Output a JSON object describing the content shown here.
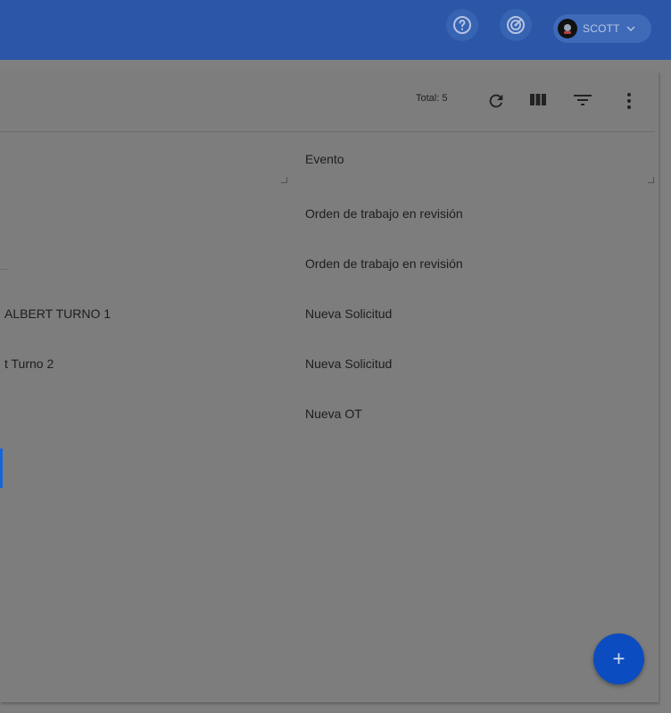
{
  "header": {
    "user_name": "SCOTT",
    "icons": [
      "help-icon",
      "target-icon",
      "avatar",
      "chevron-down-icon"
    ]
  },
  "toolbar": {
    "total_label": "Total: 5",
    "icons": [
      "refresh-icon",
      "columns-icon",
      "filter-icon",
      "more-icon"
    ]
  },
  "table": {
    "columns": [
      "Evento"
    ],
    "rows": [
      {
        "left": "",
        "evento": "Orden de trabajo en revisión"
      },
      {
        "left": "",
        "evento": "Orden de trabajo en revisión"
      },
      {
        "left": "ALBERT TURNO 1",
        "evento": "Nueva Solicitud"
      },
      {
        "left": "t Turno 2",
        "evento": "Nueva Solicitud"
      },
      {
        "left": "",
        "evento": "Nueva OT"
      }
    ]
  },
  "fab": {
    "label": "+"
  },
  "colors": {
    "header": "#2c56a8",
    "fab": "#0b4cc0",
    "accent": "#1764d6"
  }
}
